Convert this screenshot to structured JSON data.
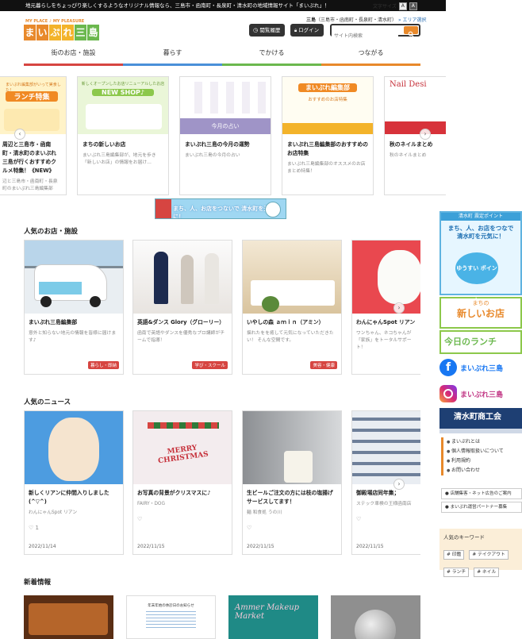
{
  "topbar": {
    "tagline": "地元暮らしをちょっぴり楽しくするようなオリジナル情報なら、三島市・函南町・長泉町・清水町の地域情報サイト「まいぷれ」！",
    "font_size_label": "文字サイズ",
    "font_small": "A",
    "font_large": "A"
  },
  "header": {
    "logo_tagline": "MY PLACE ♪ MY PLEASURE",
    "logo_chars": [
      "ま",
      "い",
      "ぷ",
      "れ",
      "三",
      "島"
    ],
    "area_name": "三島",
    "area_detail": "（三島市・函南町・長泉町・清水町）",
    "area_select": "» エリア選択",
    "history_label": "閲覧履歴",
    "login_label": "ログイン",
    "search_placeholder": "サイト内検索"
  },
  "nav": {
    "items": [
      "街のお店・施設",
      "暮らす",
      "でかける",
      "つながる"
    ]
  },
  "carousel": {
    "cards": [
      {
        "img_text": "ランチ特集",
        "img_sub": "まいぷれ編集部がいって実食した！",
        "title": "周辺と三島市・函南町・清水町のまいぷれ三島が行くおすすめクルメ特集！《NEW》",
        "desc": "辺と三島市・函南町・長泉 町のまいぷれ三島編集部"
      },
      {
        "img_text": "NEW SHOP♪",
        "img_sub": "新しくオープンしたお店リニューアルしたお店",
        "title": "まちの新しいお店",
        "desc": "まいぷれ三島編集部が、地元を歩き「新しいお店」の情報をお届け…"
      },
      {
        "img_text": "",
        "band": "今月の占い",
        "title": "まいぷれ三島の今月の運勢",
        "desc": "まいぷれ三島の今月の占い"
      },
      {
        "img_text": "まいぷれ編集部",
        "img_sub": "おすすめのお店特集",
        "title": "まいぷれ三島編集部のおすすめのお店特集",
        "desc": "まいぷれ三島編集部のオススメのお店まとめ特集！"
      },
      {
        "img_text": "Nail Desi",
        "band": "",
        "title": "秋のネイルまとめ",
        "desc": "秋のネイルまとめ"
      }
    ]
  },
  "mid_banner": {
    "text": "まち、人、お店をつないで 清水町を元気に！",
    "badge": "清水町 ゆうすいポイント"
  },
  "popular_shops": {
    "title": "人気のお店・施設",
    "items": [
      {
        "name": "まいぷれ三島編集部",
        "desc": "意外と知らない地元の情報を皆様に届けます♪",
        "tag": "暮らし・即納"
      },
      {
        "name": "英語&ダンス Glory（グローリー）",
        "desc": "函南で英語やダンスを優秀なプロ講師がチームで指導！",
        "tag": "学び・スクール"
      },
      {
        "name": "いやしの森 ａｍｉｎ（アミン）",
        "desc": "揺れたをを癒して元気になっていただきたい！ そんな空間です。",
        "tag": "美容・健康"
      },
      {
        "name": "わんにゃんSpot リアン",
        "desc": "ワンちゃん、ネコちゃんが「家族」をトータルサポート！",
        "tag": ""
      }
    ]
  },
  "popular_news": {
    "title": "人気のニュース",
    "items": [
      {
        "title": "新しくリアンに仲間入りしました(^▽^)",
        "source": "わんにゃんSpot リアン",
        "likes": "1",
        "date": "2022/11/14"
      },
      {
        "title": "お写真の背景がクリスマスに♪",
        "source": "FAIRY・DOG",
        "likes": "",
        "date": "2022/11/15"
      },
      {
        "title": "生ビールご注文の方には枝の塩揚げサービスしてます！",
        "source": "麺 和食処 うの川",
        "likes": "",
        "date": "2022/11/15"
      },
      {
        "title": "御殿場店同年集；",
        "source": "ステック車検の王様函南店",
        "likes": "",
        "date": "2022/11/15"
      }
    ]
  },
  "new_info": {
    "title": "新着情報",
    "notice_title": "年末年始の休診日のお知らせ",
    "market_text": "Ammer Makeup Market"
  },
  "sidebar": {
    "banner1_top": "清水町 震定ポイント",
    "banner1_text": "まち、人、お店をつなで 清水町を元気に！",
    "banner1_badge": "ゆうすい ポイント",
    "banner2_small": "まちの",
    "banner2_text": "新しいお店",
    "banner3_text": "今日のランチ",
    "facebook_label": "まいぷれ三島",
    "instagram_label": "まいぷれ三島",
    "shoko_text": "清水町商工会",
    "links": [
      "まいぷれとは",
      "個人情報取扱いについて",
      "利用規約",
      "お問い合わせ"
    ],
    "box1": "店舗集客・ネット広告のご案内",
    "box2": "まいぷれ運営パートナー募集",
    "keywords_title": "人気のキーワード",
    "keywords": [
      "# 印鑑",
      "# テイクアウト",
      "# ランチ",
      "# ネイル"
    ]
  },
  "colors": {
    "accent": "#e8892b",
    "tag_red": "#d64541",
    "nav_blue": "#4a90d9",
    "nav_green": "#6bb84e"
  }
}
